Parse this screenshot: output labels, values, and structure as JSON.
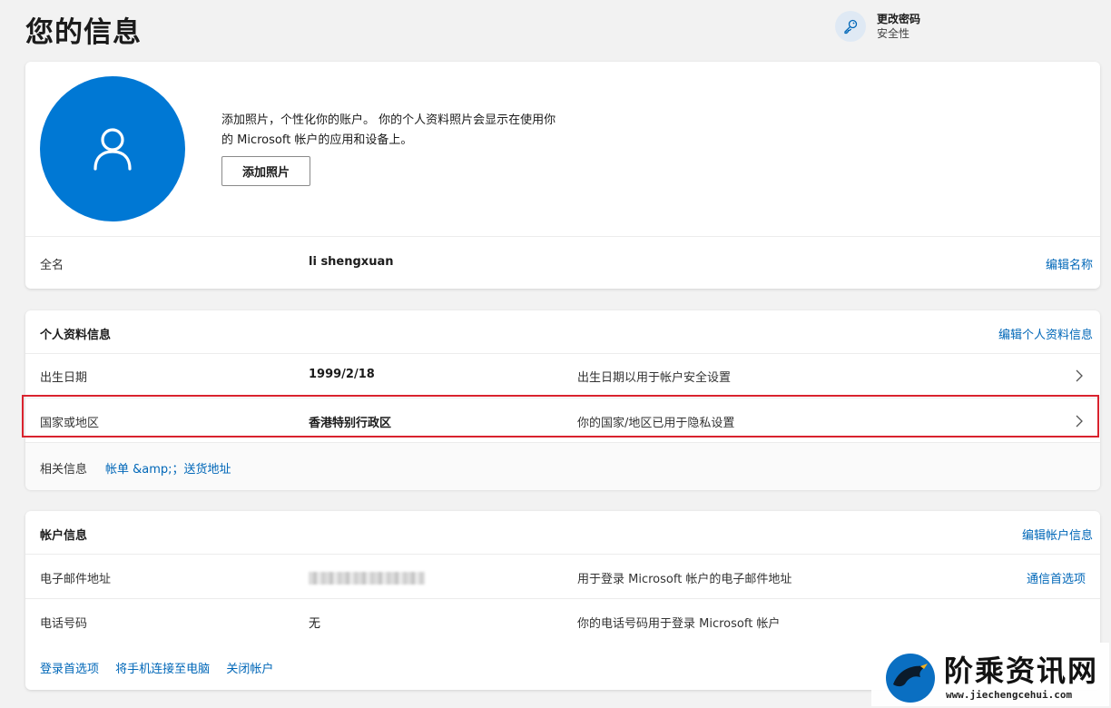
{
  "page": {
    "title": "您的信息",
    "change_password": {
      "title": "更改密码",
      "subtitle": "安全性",
      "icon": "key-icon"
    }
  },
  "profile": {
    "avatar_icon": "person-icon",
    "photo_description": "添加照片，个性化你的账户。 你的个人资料照片会显示在使用你的 Microsoft 帐户的应用和设备上。",
    "add_photo_label": "添加照片",
    "full_name": {
      "label": "全名",
      "value": "li shengxuan",
      "action": "编辑名称"
    }
  },
  "personal": {
    "header": "个人资料信息",
    "edit_label": "编辑个人资料信息",
    "rows": [
      {
        "label": "出生日期",
        "value": "1999/2/18",
        "note": "出生日期以用于帐户安全设置"
      },
      {
        "label": "国家或地区",
        "value": "香港特别行政区",
        "note": "你的国家/地区已用于隐私设置"
      }
    ],
    "related_label": "相关信息",
    "related_link": "帐单 &amp;；送货地址"
  },
  "account": {
    "header": "帐户信息",
    "edit_label": "编辑帐户信息",
    "email": {
      "label": "电子邮件地址",
      "note": "用于登录 Microsoft 帐户的电子邮件地址",
      "action": "通信首选项"
    },
    "phone": {
      "label": "电话号码",
      "value": "无",
      "note": "你的电话号码用于登录 Microsoft 帐户"
    },
    "footer_links": [
      "登录首选项",
      "将手机连接至电脑",
      "关闭帐户"
    ]
  },
  "watermark": {
    "name": "阶乘资讯网",
    "url": "www.jiechengcehui.com"
  },
  "colors": {
    "accent": "#0078d4",
    "link": "#0067b8",
    "highlight": "#d9232e",
    "background": "#f2f2f2"
  }
}
